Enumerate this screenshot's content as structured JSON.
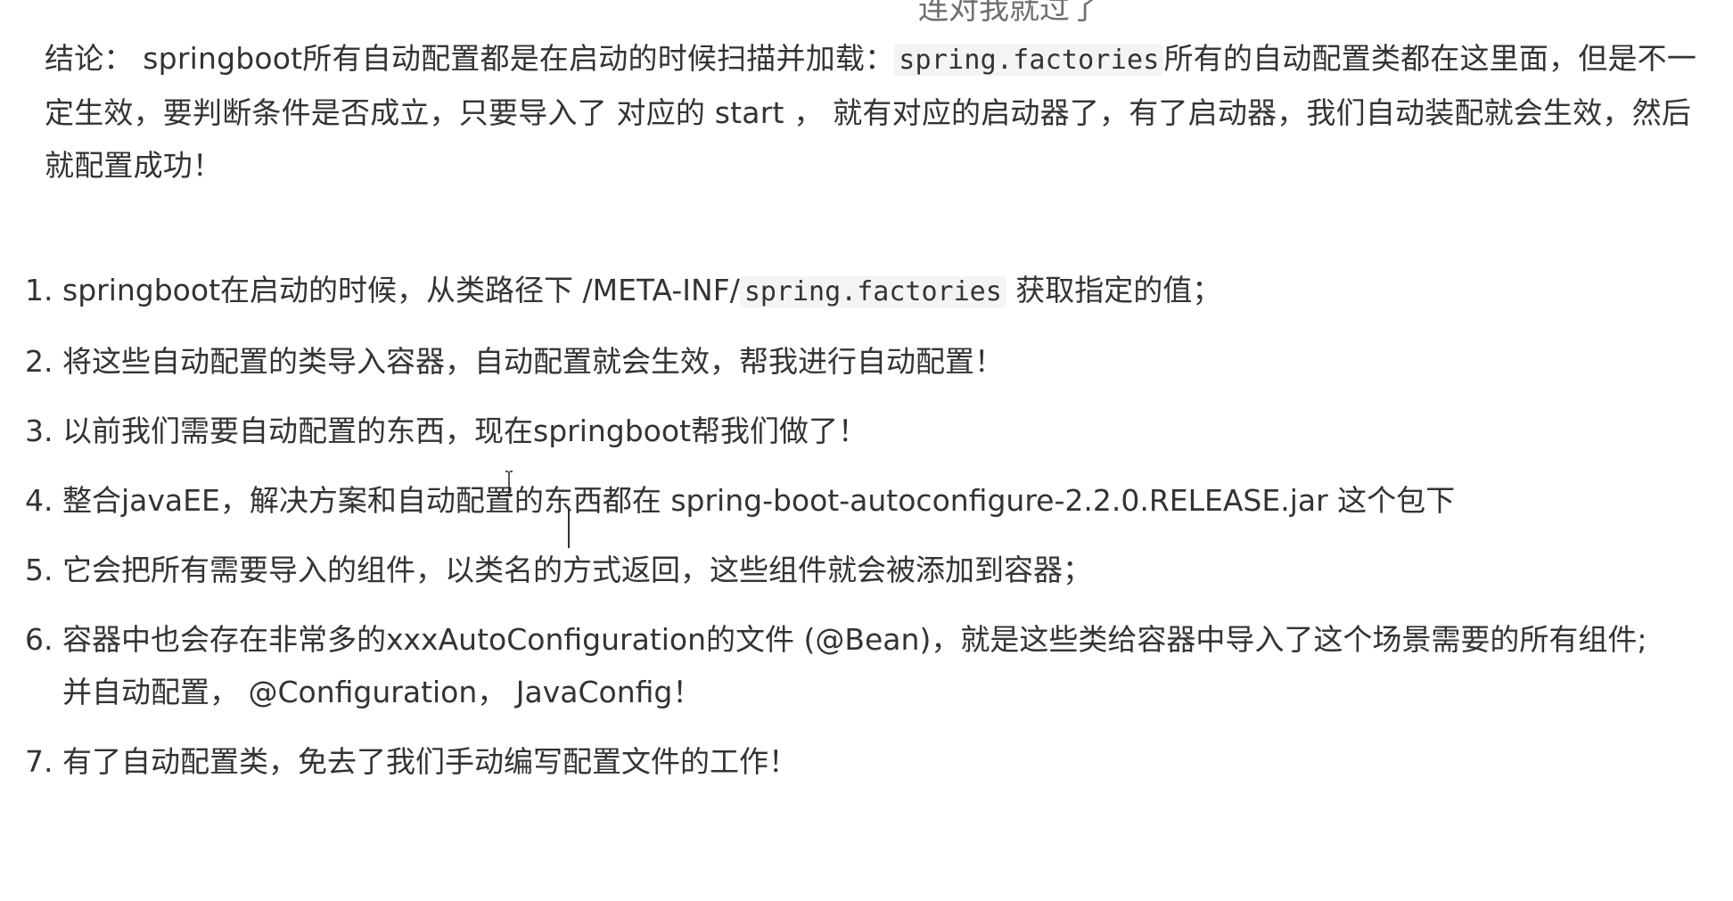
{
  "caption": {
    "text": "连对我就过了"
  },
  "conclusion": {
    "prefix": "结论： springboot所有自动配置都是在启动的时候扫描并加载：",
    "code": "spring.factories",
    "suffix": "所有的自动配置类都在这里面，但是不一定生效，要判断条件是否成立，只要导入了 对应的 start ， 就有对应的启动器了，有了启动器，我们自动装配就会生效，然后就配置成功！"
  },
  "list": [
    {
      "num": "1.",
      "before": "springboot在启动的时候，从类路径下 /META-INF/",
      "code": "spring.factories",
      "after": " 获取指定的值；"
    },
    {
      "num": "2.",
      "text": "将这些自动配置的类导入容器，自动配置就会生效，帮我进行自动配置！"
    },
    {
      "num": "3.",
      "text": "以前我们需要自动配置的东西，现在springboot帮我们做了！"
    },
    {
      "num": "4.",
      "text": "整合javaEE，解决方案和自动配置的东西都在 spring-boot-autoconfigure-2.2.0.RELEASE.jar 这个包下"
    },
    {
      "num": "5.",
      "text": "它会把所有需要导入的组件，以类名的方式返回，这些组件就会被添加到容器；"
    },
    {
      "num": "6.",
      "text": "容器中也会存在非常多的xxxAutoConfiguration的文件 (@Bean)，就是这些类给容器中导入了这个场景需要的所有组件;并自动配置， @Configuration， JavaConfig！"
    },
    {
      "num": "7.",
      "text": "有了自动配置类，免去了我们手动编写配置文件的工作！"
    }
  ],
  "icons": {
    "cursor": "text-cursor-icon"
  }
}
